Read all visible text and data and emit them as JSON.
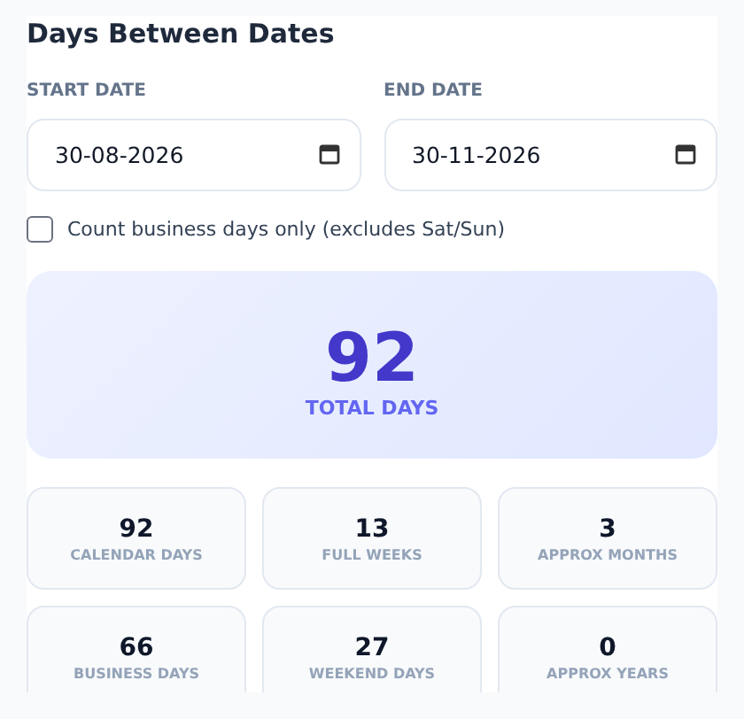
{
  "title": "Days Between Dates",
  "fields": [
    {
      "label": "START DATE",
      "value": "30-08-2026"
    },
    {
      "label": "END DATE",
      "value": "30-11-2026"
    }
  ],
  "business_only": {
    "label": "Count business days only (excludes Sat/Sun)",
    "checked": false
  },
  "total": {
    "value": "92",
    "label": "TOTAL DAYS"
  },
  "stats": [
    {
      "value": "92",
      "label": "CALENDAR DAYS"
    },
    {
      "value": "13",
      "label": "FULL WEEKS"
    },
    {
      "value": "3",
      "label": "APPROX MONTHS"
    },
    {
      "value": "66",
      "label": "BUSINESS DAYS"
    },
    {
      "value": "27",
      "label": "WEEKEND DAYS"
    },
    {
      "value": "0",
      "label": "APPROX YEARS"
    }
  ]
}
